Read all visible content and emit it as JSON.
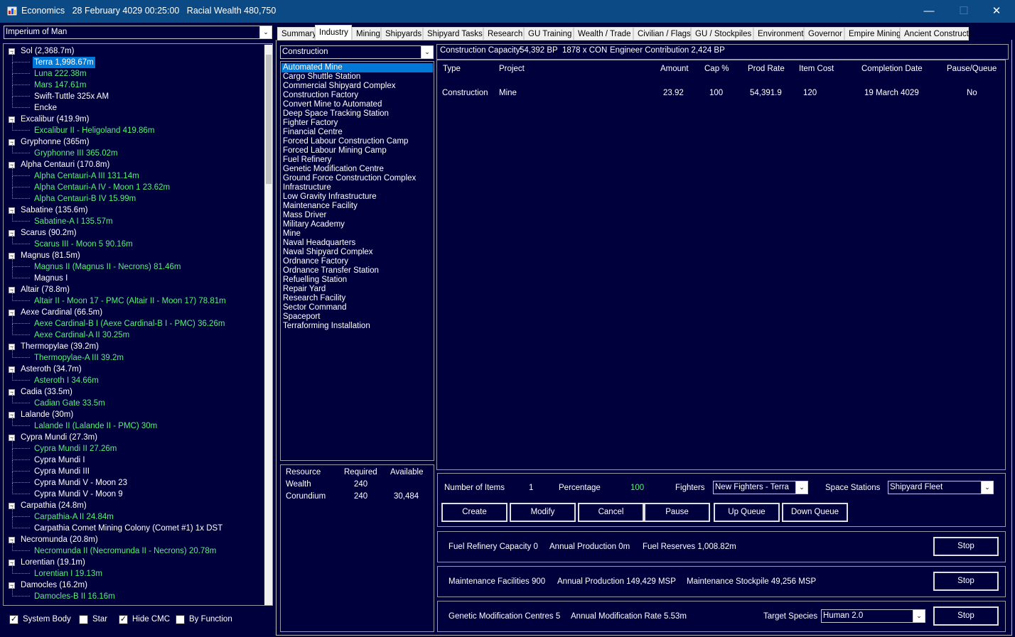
{
  "window": {
    "app": "Economics",
    "datetime": "28 February 4029 00:25:00",
    "wealth": "Racial Wealth 480,750",
    "minimize_glyph": "—",
    "maximize_glyph": "☐",
    "close_glyph": "✕"
  },
  "empire_select": "Imperium of Man",
  "tree": [
    {
      "label": "Sol  (2,368.7m)",
      "level": 0,
      "box": "-"
    },
    {
      "label": "Terra  1,998.67m",
      "level": 1,
      "style": "selected"
    },
    {
      "label": "Luna  222.38m",
      "level": 1,
      "style": "green"
    },
    {
      "label": "Mars  147.61m",
      "level": 1,
      "style": "green"
    },
    {
      "label": "Swift-Tuttle  325x AM",
      "level": 1,
      "style": "white"
    },
    {
      "label": "Encke",
      "level": 1,
      "style": "white"
    },
    {
      "label": "Excalibur  (419.9m)",
      "level": 0,
      "box": "-"
    },
    {
      "label": "Excalibur II - Heligoland  419.86m",
      "level": 1,
      "style": "green"
    },
    {
      "label": "Gryphonne  (365m)",
      "level": 0,
      "box": "-"
    },
    {
      "label": "Gryphonne III  365.02m",
      "level": 1,
      "style": "green"
    },
    {
      "label": "Alpha Centauri  (170.8m)",
      "level": 0,
      "box": "-"
    },
    {
      "label": "Alpha Centauri-A III  131.14m",
      "level": 1,
      "style": "green"
    },
    {
      "label": "Alpha Centauri-A IV - Moon 1  23.62m",
      "level": 1,
      "style": "green"
    },
    {
      "label": "Alpha Centauri-B IV  15.99m",
      "level": 1,
      "style": "green"
    },
    {
      "label": "Sabatine  (135.6m)",
      "level": 0,
      "box": "-"
    },
    {
      "label": "Sabatine-A I  135.57m",
      "level": 1,
      "style": "green"
    },
    {
      "label": "Scarus  (90.2m)",
      "level": 0,
      "box": "-"
    },
    {
      "label": "Scarus III - Moon 5  90.16m",
      "level": 1,
      "style": "green"
    },
    {
      "label": "Magnus  (81.5m)",
      "level": 0,
      "box": "-"
    },
    {
      "label": "Magnus II (Magnus II - Necrons)  81.46m",
      "level": 1,
      "style": "green"
    },
    {
      "label": "Magnus I",
      "level": 1,
      "style": "white"
    },
    {
      "label": "Altair  (78.8m)",
      "level": 0,
      "box": "-"
    },
    {
      "label": "Altair II - Moon 17 - PMC (Altair II - Moon 17)  78.81m",
      "level": 1,
      "style": "green"
    },
    {
      "label": "Aexe Cardinal  (66.5m)",
      "level": 0,
      "box": "-"
    },
    {
      "label": "Aexe Cardinal-B I (Aexe Cardinal-B I - PMC)  36.26m",
      "level": 1,
      "style": "green"
    },
    {
      "label": "Aexe Cardinal-A II  30.25m",
      "level": 1,
      "style": "green"
    },
    {
      "label": "Thermopylae  (39.2m)",
      "level": 0,
      "box": "-"
    },
    {
      "label": "Thermopylae-A III  39.2m",
      "level": 1,
      "style": "green"
    },
    {
      "label": "Asteroth  (34.7m)",
      "level": 0,
      "box": "-"
    },
    {
      "label": "Asteroth I  34.66m",
      "level": 1,
      "style": "green"
    },
    {
      "label": "Cadia  (33.5m)",
      "level": 0,
      "box": "-"
    },
    {
      "label": "Cadian Gate  33.5m",
      "level": 1,
      "style": "green"
    },
    {
      "label": "Lalande  (30m)",
      "level": 0,
      "box": "-"
    },
    {
      "label": "Lalande II (Lalande II - PMC)  30m",
      "level": 1,
      "style": "green"
    },
    {
      "label": "Cypra Mundi  (27.3m)",
      "level": 0,
      "box": "-"
    },
    {
      "label": "Cypra Mundi II  27.26m",
      "level": 1,
      "style": "green"
    },
    {
      "label": "Cypra Mundi I",
      "level": 1,
      "style": "white"
    },
    {
      "label": "Cypra Mundi III",
      "level": 1,
      "style": "white"
    },
    {
      "label": "Cypra Mundi V - Moon 23",
      "level": 1,
      "style": "white"
    },
    {
      "label": "Cypra Mundi V - Moon 9",
      "level": 1,
      "style": "white"
    },
    {
      "label": "Carpathia  (24.8m)",
      "level": 0,
      "box": "-"
    },
    {
      "label": "Carpathia-A II  24.84m",
      "level": 1,
      "style": "green"
    },
    {
      "label": "Carpathia Comet Mining Colony (Comet #1)  1x DST",
      "level": 1,
      "style": "white"
    },
    {
      "label": "Necromunda  (20.8m)",
      "level": 0,
      "box": "-"
    },
    {
      "label": "Necromunda II (Necromunda II - Necrons)  20.78m",
      "level": 1,
      "style": "green"
    },
    {
      "label": "Lorentian  (19.1m)",
      "level": 0,
      "box": "-"
    },
    {
      "label": "Lorentian I  19.13m",
      "level": 1,
      "style": "green"
    },
    {
      "label": "Damocles  (16.2m)",
      "level": 0,
      "box": "-"
    },
    {
      "label": "Damocles-B II  16.16m",
      "level": 1,
      "style": "green"
    }
  ],
  "tree_box_glyph": "−",
  "filters": [
    {
      "label": "System Body",
      "checked": true
    },
    {
      "label": "Star",
      "checked": false
    },
    {
      "label": "Hide CMC",
      "checked": true
    },
    {
      "label": "By Function",
      "checked": false
    }
  ],
  "check_glyph": "✓",
  "tabs": [
    "Summary",
    "Industry",
    "Mining",
    "Shipyards",
    "Shipyard Tasks",
    "Research",
    "GU Training",
    "Wealth / Trade",
    "Civilian / Flags",
    "GU / Stockpiles",
    "Environment",
    "Governor",
    "Empire Mining",
    "Ancient Constructs"
  ],
  "active_tab": "Industry",
  "production_type": "Construction",
  "projects": [
    "Automated Mine",
    "Cargo Shuttle Station",
    "Commercial Shipyard Complex",
    "Construction Factory",
    "Convert Mine to Automated",
    "Deep Space Tracking Station",
    "Fighter Factory",
    "Financial Centre",
    "Forced Labour Construction Camp",
    "Forced Labour Mining Camp",
    "Fuel Refinery",
    "Genetic Modification Centre",
    "Ground Force Construction Complex",
    "Infrastructure",
    "Low Gravity Infrastructure",
    "Maintenance Facility",
    "Mass Driver",
    "Military Academy",
    "Mine",
    "Naval Headquarters",
    "Naval Shipyard Complex",
    "Ordnance Factory",
    "Ordnance Transfer Station",
    "Refuelling Station",
    "Repair Yard",
    "Research Facility",
    "Sector Command",
    "Spaceport",
    "Terraforming Installation"
  ],
  "selected_project": "Automated Mine",
  "resources": {
    "headers": [
      "Resource",
      "Required",
      "Available"
    ],
    "rows": [
      [
        "Wealth",
        "240",
        ""
      ],
      [
        "Corundium",
        "240",
        "30,484"
      ]
    ]
  },
  "capacity": {
    "label": "Construction Capacity:",
    "bp": "54,392 BP",
    "con": "1878 x CON",
    "engineer": "Engineer Contribution 2,424 BP"
  },
  "queue": {
    "headers": [
      "Type",
      "Project",
      "Amount",
      "Cap %",
      "Prod Rate",
      "Item Cost",
      "Completion Date",
      "Pause/Queue"
    ],
    "rows": [
      [
        "Construction",
        "Mine",
        "23.92",
        "100",
        "54,391.9",
        "120",
        "19 March 4029",
        "No"
      ]
    ]
  },
  "order": {
    "items_label": "Number of Items",
    "items_value": "1",
    "pct_label": "Percentage",
    "pct_value": "100",
    "fighters_label": "Fighters",
    "fighters_value": "New Fighters - Terra",
    "stations_label": "Space Stations",
    "stations_value": "Shipyard Fleet",
    "buttons": [
      "Create",
      "Modify",
      "Cancel",
      "Pause",
      "Up Queue",
      "Down Queue"
    ]
  },
  "fuel": {
    "capacity": "Fuel Refinery Capacity  0",
    "annual": "Annual Production  0m",
    "reserves": "Fuel Reserves  1,008.82m",
    "button": "Stop"
  },
  "maint": {
    "facilities": "Maintenance Facilities  900",
    "annual": "Annual Production  149,429 MSP",
    "stockpile": "Maintenance Stockpile  49,256 MSP",
    "button": "Stop"
  },
  "genetic": {
    "centres": "Genetic Modification Centres  5",
    "rate": "Annual Modification Rate  5.53m",
    "target_label": "Target Species",
    "target_value": "Human 2.0",
    "button": "Stop"
  },
  "dropdown_glyph": "⌄",
  "colors": {
    "background": "#00003c",
    "titlebar": "#0c4a86",
    "selected": "#0078d7",
    "populated": "#59f07a"
  }
}
